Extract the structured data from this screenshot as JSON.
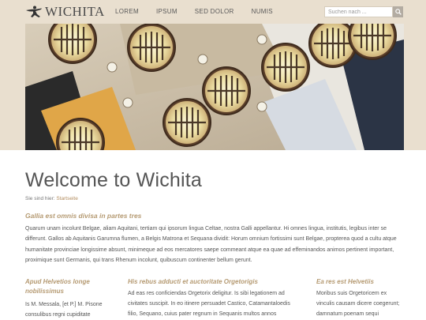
{
  "header": {
    "logo_text": "WICHITA",
    "nav": [
      "LOREM",
      "IPSUM",
      "SED DOLOR",
      "NUMIS"
    ],
    "search": {
      "placeholder": "Suchen nach ..."
    }
  },
  "main": {
    "title": "Welcome to Wichita",
    "breadcrumb": {
      "label": "Sie sind hier:",
      "link": "Startseite"
    },
    "intro_heading": "Gallia est omnis divisa in partes tres",
    "intro_text": "Quarum unam incolunt Belgae, aliam Aquitani, tertiam qui ipsorum lingua Celtae, nostra Galli appellantur. Hi omnes lingua, institutis, legibus inter se differunt. Gallos ab Aquitanis Garumna flumen, a Belgis Matrona et Sequana dividit: Horum omnium fortissimi sunt Belgae, propterea quod a cultu atque humanitate provinciae longissime absunt, minimeque ad eos mercatores saepe commeant atque ea quae ad effeminandos animos pertinent important, proximique sunt Germanis, qui trans Rhenum incolunt, quibuscum continenter bellum gerunt.",
    "columns": [
      {
        "heading": "Apud Helvetios longe nobilissimus",
        "text": "Is M. Messala, [et P.] M. Pisone consulibus regni cupiditate"
      },
      {
        "heading": "His rebus adducti et auctoritate Orgetorigis",
        "text": "Ad eas res conficiendas Orgetorix deligitur. Is sibi legationem ad civitates suscipit. In eo itinere persuadet Castico, Catamantaloedis filio, Sequano, cuius pater regnum in Sequanis multos annos obtinuerat et a"
      },
      {
        "heading": "Ea res est Helvetiis",
        "text": "Moribus suis Orgetoricem ex vinculis causam dicere coegerunt; damnatum poenam sequi"
      }
    ]
  },
  "colors": {
    "band": "#e9dfcf",
    "accent": "#b59a72",
    "link": "#b28c5e"
  },
  "icons": {
    "logo": "running-figure-icon",
    "search": "search-icon"
  }
}
